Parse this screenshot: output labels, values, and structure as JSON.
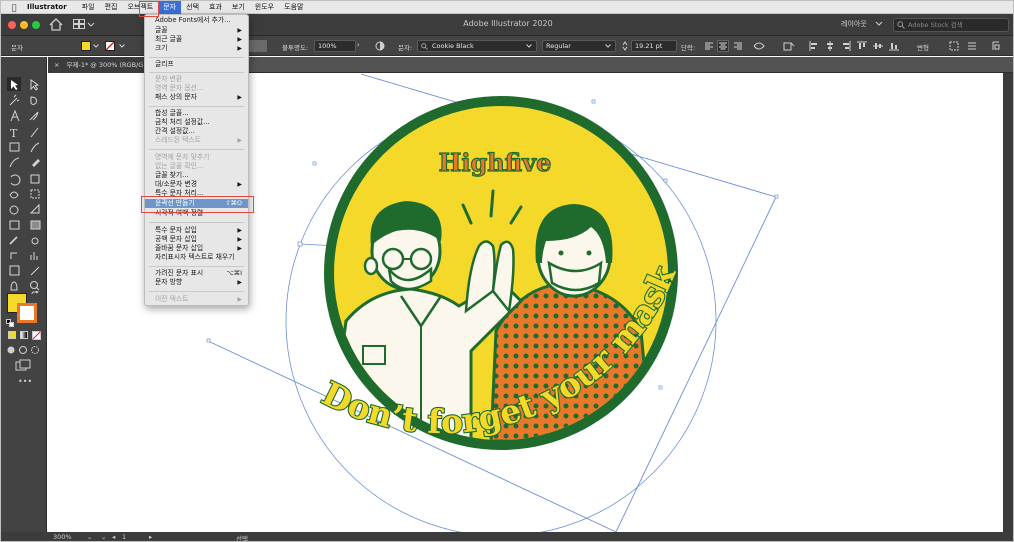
{
  "menubar": {
    "app_name": "Illustrator",
    "items": [
      "파일",
      "편집",
      "오브젝트",
      "문자",
      "선택",
      "효과",
      "보기",
      "윈도우",
      "도움말"
    ],
    "active_item": "문자"
  },
  "titlebar": {
    "title": "Adobe Illustrator 2020",
    "layout_label": "레이아웃",
    "stock_search_placeholder": "Adobe Stock 검색"
  },
  "controlbar": {
    "type_label": "문자",
    "opacity_label": "불투명도:",
    "opacity_value": "100%",
    "char_label": "문자:",
    "font_family": "Cookie Black",
    "font_style": "Regular",
    "font_size": "19.21 pt",
    "paragraph_label": "단락:",
    "transform_label": "변형"
  },
  "document": {
    "tab_label": "무제-1* @ 300% (RGB/G",
    "zoom": "300%",
    "artboard_num": "1",
    "status_tool": "선택"
  },
  "type_menu": {
    "items": [
      {
        "label": "Adobe Fonts에서 추가...",
        "enabled": true,
        "submenu": false,
        "shortcut": ""
      },
      {
        "label": "글꼴",
        "enabled": true,
        "submenu": true,
        "shortcut": ""
      },
      {
        "label": "최근 글꼴",
        "enabled": true,
        "submenu": true,
        "shortcut": ""
      },
      {
        "label": "크기",
        "enabled": true,
        "submenu": true,
        "shortcut": ""
      },
      {
        "label": "글리프",
        "enabled": true,
        "submenu": false,
        "shortcut": ""
      },
      {
        "label": "문자 변환",
        "enabled": false,
        "submenu": false,
        "shortcut": ""
      },
      {
        "label": "영역 문자 옵션...",
        "enabled": false,
        "submenu": false,
        "shortcut": ""
      },
      {
        "label": "패스 상의 문자",
        "enabled": true,
        "submenu": true,
        "shortcut": ""
      },
      {
        "label": "합성 글꼴...",
        "enabled": true,
        "submenu": false,
        "shortcut": ""
      },
      {
        "label": "금칙 처리 설정값...",
        "enabled": true,
        "submenu": false,
        "shortcut": ""
      },
      {
        "label": "간격 설정값...",
        "enabled": true,
        "submenu": false,
        "shortcut": ""
      },
      {
        "label": "스레드된 텍스트",
        "enabled": false,
        "submenu": true,
        "shortcut": ""
      },
      {
        "label": "영역에 문자 맞추기",
        "enabled": false,
        "submenu": false,
        "shortcut": ""
      },
      {
        "label": "없는 글꼴 확인...",
        "enabled": false,
        "submenu": false,
        "shortcut": ""
      },
      {
        "label": "글꼴 찾기...",
        "enabled": true,
        "submenu": false,
        "shortcut": ""
      },
      {
        "label": "대/소문자 변경",
        "enabled": true,
        "submenu": true,
        "shortcut": ""
      },
      {
        "label": "특수 문자 처리...",
        "enabled": true,
        "submenu": false,
        "shortcut": ""
      },
      {
        "label": "윤곽선 만들기",
        "enabled": true,
        "submenu": false,
        "shortcut": "⇧⌘O",
        "highlighted": true
      },
      {
        "label": "시각적 여백 정렬",
        "enabled": true,
        "submenu": false,
        "shortcut": ""
      },
      {
        "label": "특수 문자 삽입",
        "enabled": true,
        "submenu": true,
        "shortcut": ""
      },
      {
        "label": "공백 문자 삽입",
        "enabled": true,
        "submenu": true,
        "shortcut": ""
      },
      {
        "label": "줄바꿈 문자 삽입",
        "enabled": true,
        "submenu": true,
        "shortcut": ""
      },
      {
        "label": "자리표시자 텍스트로 채우기",
        "enabled": true,
        "submenu": false,
        "shortcut": ""
      },
      {
        "label": "가려진 문자 표시",
        "enabled": true,
        "submenu": false,
        "shortcut": "⌥⌘I"
      },
      {
        "label": "문자 방향",
        "enabled": true,
        "submenu": true,
        "shortcut": ""
      },
      {
        "label": "이전 텍스트",
        "enabled": false,
        "submenu": true,
        "shortcut": ""
      }
    ]
  },
  "artwork": {
    "title_text": "Highfive",
    "curved_text": "Don’t forget your mask",
    "colors": {
      "yellow": "#f4d92a",
      "green": "#1f6b2e",
      "orange": "#e8792a",
      "cream": "#fbf7ec"
    }
  },
  "swatches": {
    "fill": "#f4d92a",
    "stroke": "#e8792a"
  }
}
